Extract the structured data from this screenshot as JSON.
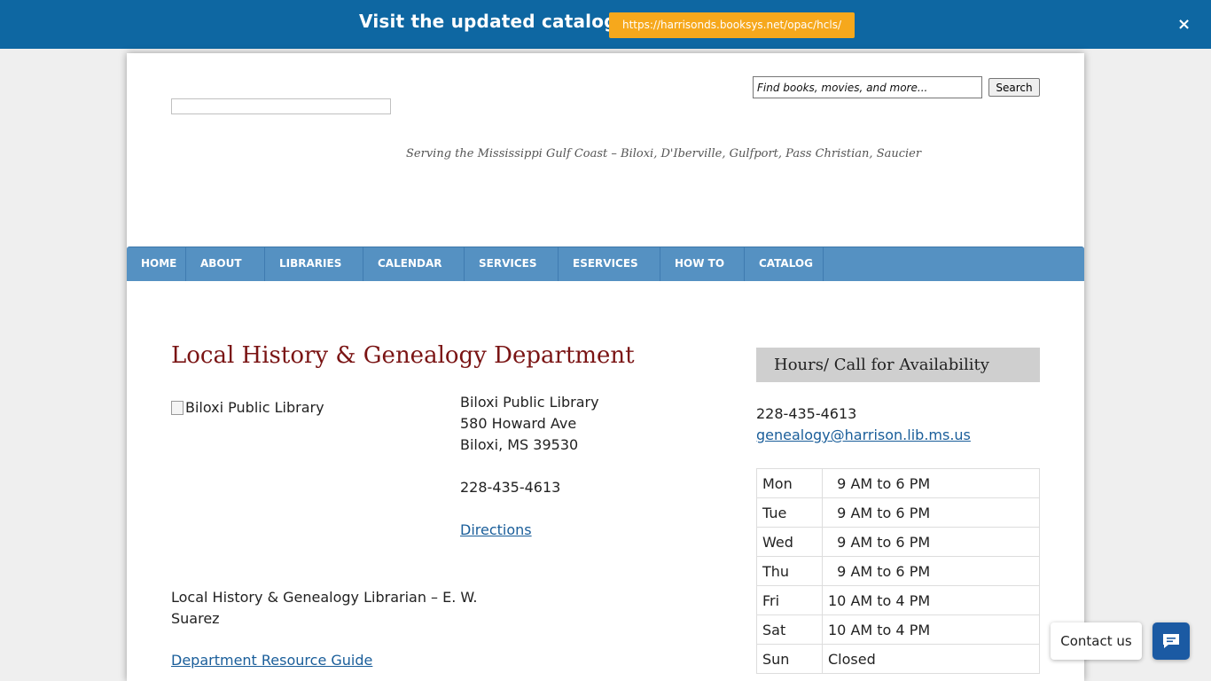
{
  "banner": {
    "text": "Visit the updated catalog!",
    "link": "https://harrisonds.booksys.net/opac/hcls/",
    "close": "×"
  },
  "header": {
    "tagline": "Serving the Mississippi Gulf Coast – Biloxi, D'Iberville, Gulfport, Pass Christian, Saucier",
    "search_placeholder": "Find books, movies, and more...",
    "search_button": "Search"
  },
  "nav": {
    "items": [
      "HOME",
      "ABOUT",
      "LIBRARIES",
      "CALENDAR",
      "SERVICES",
      "ESERVICES",
      "HOW TO",
      "CATALOG"
    ]
  },
  "main": {
    "title": "Local History & Genealogy Department",
    "image_alt": "Biloxi Public Library",
    "address": {
      "name": "Biloxi Public Library",
      "street": "580 Howard Ave",
      "city": "Biloxi, MS 39530",
      "phone": "228-435-4613",
      "directions": "Directions"
    },
    "librarian": "Local History & Genealogy Librarian – E. W. Suarez",
    "resource_guide": "Department Resource Guide"
  },
  "sidebar": {
    "heading": "Hours/ Call for Availability",
    "phone": "228-435-4613",
    "email": "genealogy@harrison.lib.ms.us",
    "hours": [
      {
        "day": "Mon",
        "time": "  9 AM to 6 PM"
      },
      {
        "day": "Tue",
        "time": "  9 AM to 6 PM"
      },
      {
        "day": "Wed",
        "time": "  9 AM to 6 PM"
      },
      {
        "day": "Thu",
        "time": "  9 AM to 6 PM"
      },
      {
        "day": "Fri",
        "time": "10 AM to 4 PM"
      },
      {
        "day": "Sat",
        "time": "10 AM to 4 PM"
      },
      {
        "day": "Sun",
        "time": "Closed"
      }
    ]
  },
  "chat": {
    "label": "Contact us",
    "icon": "chat-icon"
  },
  "colors": {
    "banner": "#0e67a2",
    "banner_link": "#f6a81c",
    "nav": "#5591c2",
    "title": "#7a1414",
    "chat": "#1b5aa3"
  }
}
